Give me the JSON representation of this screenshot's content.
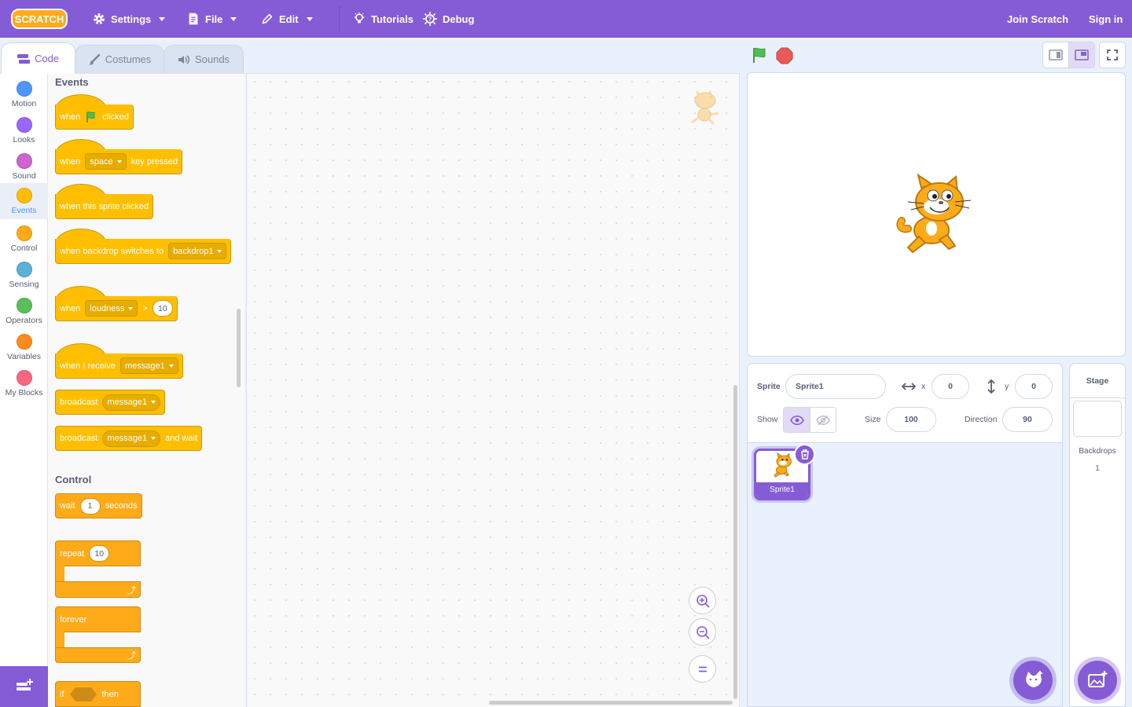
{
  "menubar": {
    "logo_text": "SCRATCH",
    "settings": "Settings",
    "file": "File",
    "edit": "Edit",
    "tutorials": "Tutorials",
    "debug": "Debug",
    "join": "Join Scratch",
    "signin": "Sign in"
  },
  "tabs": [
    "Code",
    "Costumes",
    "Sounds"
  ],
  "categories": [
    {
      "label": "Motion",
      "color": "#4c97ff"
    },
    {
      "label": "Looks",
      "color": "#9966ff"
    },
    {
      "label": "Sound",
      "color": "#cf63cf"
    },
    {
      "label": "Events",
      "color": "#ffbf00"
    },
    {
      "label": "Control",
      "color": "#ffab19"
    },
    {
      "label": "Sensing",
      "color": "#5cb1d6"
    },
    {
      "label": "Operators",
      "color": "#59c059"
    },
    {
      "label": "Variables",
      "color": "#ff8c1a"
    },
    {
      "label": "My Blocks",
      "color": "#ff6680"
    }
  ],
  "palette": {
    "events_title": "Events",
    "control_title": "Control",
    "b1": {
      "when": "when",
      "clicked": "clicked"
    },
    "b2": {
      "when": "when",
      "key": "space",
      "pressed": "key pressed"
    },
    "b3": {
      "text": "when this sprite clicked"
    },
    "b4": {
      "text": "when backdrop switches to",
      "backdrop": "backdrop1"
    },
    "b5": {
      "when": "when",
      "sensor": "loudness",
      "gt": ">",
      "value": "10"
    },
    "b6": {
      "text": "when I receive",
      "message": "message1"
    },
    "b7": {
      "text": "broadcast",
      "message": "message1"
    },
    "b8": {
      "text": "broadcast",
      "message": "message1",
      "wait": "and wait"
    },
    "c1": {
      "wait": "wait",
      "value": "1",
      "seconds": "seconds"
    },
    "c2": {
      "repeat": "repeat",
      "value": "10"
    },
    "c3": {
      "forever": "forever"
    },
    "c4": {
      "if": "if",
      "then": "then"
    }
  },
  "sprite_info": {
    "sprite_label": "Sprite",
    "sprite_name": "Sprite1",
    "x_label": "x",
    "x_value": "0",
    "y_label": "y",
    "y_value": "0",
    "show_label": "Show",
    "size_label": "Size",
    "size_value": "100",
    "direction_label": "Direction",
    "direction_value": "90"
  },
  "sprites": [
    {
      "name": "Sprite1"
    }
  ],
  "stage_pane": {
    "title": "Stage",
    "backdrops_label": "Backdrops",
    "backdrops_count": "1"
  }
}
